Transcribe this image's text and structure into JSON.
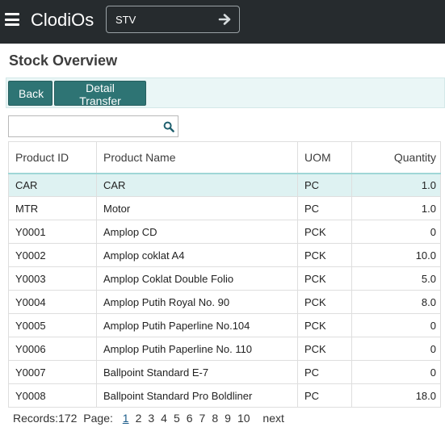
{
  "app": {
    "title": "ClodiOs",
    "context_value": "STV",
    "icons": {
      "menu": "hamburger-icon",
      "context_go": "arrow-right-icon"
    }
  },
  "page": {
    "title": "Stock Overview"
  },
  "toolbar": {
    "back_label": "Back",
    "detail_label": "Detail Transfer"
  },
  "search": {
    "value": "",
    "placeholder": "",
    "icon": "search-icon"
  },
  "table": {
    "columns": [
      "Product ID",
      "Product Name",
      "UOM",
      "Quantity"
    ],
    "rows": [
      {
        "id": "CAR",
        "name": "CAR",
        "uom": "PC",
        "qty": "1.0",
        "selected": true
      },
      {
        "id": "MTR",
        "name": "Motor",
        "uom": "PC",
        "qty": "1.0"
      },
      {
        "id": "Y0001",
        "name": "Amplop CD",
        "uom": "PCK",
        "qty": "0"
      },
      {
        "id": "Y0002",
        "name": "Amplop coklat A4",
        "uom": "PCK",
        "qty": "10.0"
      },
      {
        "id": "Y0003",
        "name": "Amplop Coklat Double Folio",
        "uom": "PCK",
        "qty": "5.0"
      },
      {
        "id": "Y0004",
        "name": "Amplop Putih Royal No. 90",
        "uom": "PCK",
        "qty": "8.0"
      },
      {
        "id": "Y0005",
        "name": "Amplop Putih Paperline No.104",
        "uom": "PCK",
        "qty": "0"
      },
      {
        "id": "Y0006",
        "name": "Amplop Putih Paperline No. 110",
        "uom": "PCK",
        "qty": "0"
      },
      {
        "id": "Y0007",
        "name": "Ballpoint Standard E-7",
        "uom": "PC",
        "qty": "0"
      },
      {
        "id": "Y0008",
        "name": "Ballpoint Standard Pro Boldliner",
        "uom": "PC",
        "qty": "18.0"
      }
    ]
  },
  "pager": {
    "records_label": "Records:172",
    "page_label": "Page:",
    "pages": [
      "1",
      "2",
      "3",
      "4",
      "5",
      "6",
      "7",
      "8",
      "9",
      "10"
    ],
    "current": "1",
    "next_label": "next"
  },
  "colors": {
    "topbar": "#262b2e",
    "accent": "#2e7474",
    "toolbar_bg": "#eaf6f6",
    "selected_row": "#def2f2",
    "header_rule": "#9fd6d6"
  }
}
